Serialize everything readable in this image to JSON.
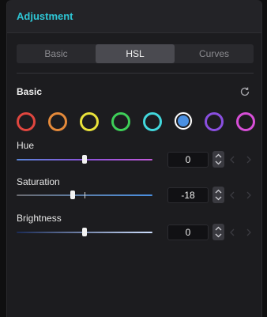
{
  "panel": {
    "title": "Adjustment"
  },
  "tabs": [
    {
      "label": "Basic",
      "active": false
    },
    {
      "label": "HSL",
      "active": true
    },
    {
      "label": "Curves",
      "active": false
    }
  ],
  "section": {
    "title": "Basic",
    "reset_icon": "reset-icon"
  },
  "swatches": [
    {
      "name": "red",
      "color": "#e0463f"
    },
    {
      "name": "orange",
      "color": "#e58a3a"
    },
    {
      "name": "yellow",
      "color": "#e9e23a"
    },
    {
      "name": "green",
      "color": "#3ecf58"
    },
    {
      "name": "cyan",
      "color": "#42d7dc"
    },
    {
      "name": "blue",
      "color": "#4a90e2",
      "selected": true
    },
    {
      "name": "purple",
      "color": "#8a4fe0"
    },
    {
      "name": "magenta",
      "color": "#d84fd8"
    }
  ],
  "sliders": [
    {
      "label": "Hue",
      "value": "0",
      "position": 0.5
    },
    {
      "label": "Saturation",
      "value": "-18",
      "position": 0.41
    },
    {
      "label": "Brightness",
      "value": "0",
      "position": 0.5
    }
  ],
  "colors": {
    "accent": "#2ec7d6",
    "hue_gradient": [
      "#5a86d8",
      "#8a52d8",
      "#c25ad8"
    ]
  }
}
